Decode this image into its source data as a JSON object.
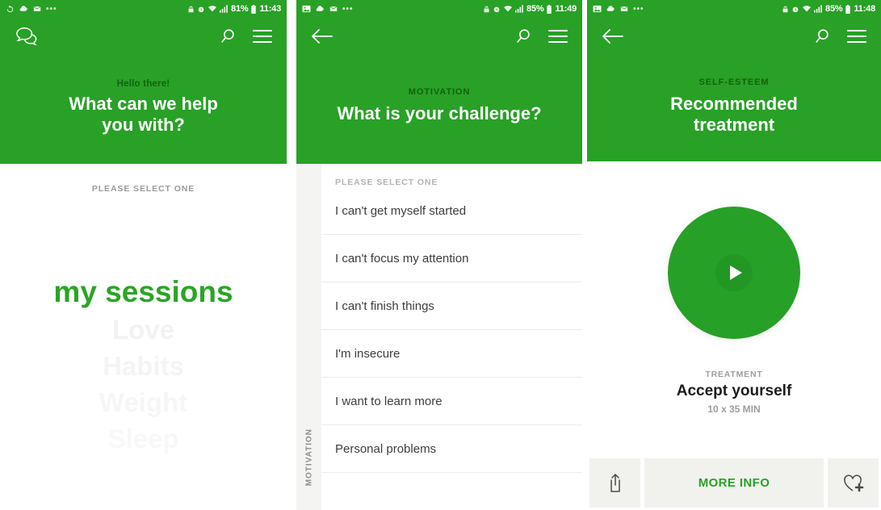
{
  "screens": [
    {
      "id": "home",
      "statusbar": {
        "left_icons": [
          "sync-icon",
          "cloud-icon",
          "mail-icon",
          "overflow-dots"
        ],
        "overflow": "•••",
        "right_icons": [
          "lock-icon",
          "alarm-icon",
          "wifi-icon",
          "signal-icon",
          "battery-icon"
        ],
        "battery": "81%",
        "time": "11:43"
      },
      "appbar": {
        "left_icon": "chat-bubbles-icon",
        "search_icon": "search-icon",
        "menu_icon": "hamburger-menu-icon"
      },
      "header": {
        "eyebrow": "Hello there!",
        "title_line1": "What can we help",
        "title_line2": "you with?"
      },
      "body": {
        "select_one": "PLEASE SELECT ONE",
        "sessions": [
          "my sessions",
          "Love",
          "Habits",
          "Weight",
          "Sleep"
        ]
      }
    },
    {
      "id": "challenge",
      "statusbar": {
        "left_icons": [
          "image-icon",
          "cloud-icon",
          "mail-icon",
          "overflow-dots"
        ],
        "overflow": "•••",
        "right_icons": [
          "lock-icon",
          "alarm-icon",
          "wifi-icon",
          "signal-icon",
          "battery-icon"
        ],
        "battery": "85%",
        "time": "11:49"
      },
      "appbar": {
        "left_icon": "back-arrow-icon",
        "search_icon": "search-icon",
        "menu_icon": "hamburger-menu-icon"
      },
      "header": {
        "eyebrow": "MOTIVATION",
        "title_line1": "What is your challenge?"
      },
      "body": {
        "rail_label": "MOTIVATION",
        "select_one": "PLEASE SELECT ONE",
        "options": [
          "I can't get myself started",
          "I can't focus my attention",
          "I can't finish things",
          "I'm insecure",
          "I want to learn more",
          "Personal problems"
        ]
      }
    },
    {
      "id": "treatment",
      "statusbar": {
        "left_icons": [
          "image-icon",
          "cloud-icon",
          "mail-icon",
          "overflow-dots"
        ],
        "overflow": "•••",
        "right_icons": [
          "lock-icon",
          "alarm-icon",
          "wifi-icon",
          "signal-icon",
          "battery-icon"
        ],
        "battery": "85%",
        "time": "11:48"
      },
      "appbar": {
        "left_icon": "back-arrow-icon",
        "search_icon": "search-icon",
        "menu_icon": "hamburger-menu-icon"
      },
      "header": {
        "eyebrow": "SELF-ESTEEM",
        "title_line1": "Recommended",
        "title_line2": "treatment"
      },
      "body": {
        "play_icon": "play-icon",
        "treatment_label": "TREATMENT",
        "treatment_title": "Accept yourself",
        "treatment_duration": "10 x 35 MIN",
        "share_icon": "share-icon",
        "more_info_label": "MORE INFO",
        "favorite_icon": "heart-plus-icon"
      }
    }
  ],
  "colors": {
    "brand_green": "#28a126",
    "header_eyebrow_green": "#15610f",
    "accent_green": "#2aa524",
    "rail_bg": "#f4f4f3",
    "bottom_bar_bg": "#f1f1ee",
    "text_dark": "#3d3d3d",
    "text_muted": "#9b9b9b"
  }
}
